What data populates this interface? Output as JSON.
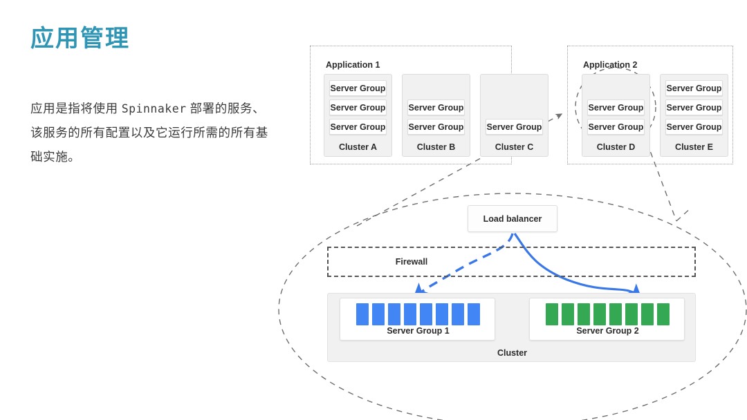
{
  "left_panel": {
    "title": "应用管理",
    "paragraph_part1": "应用是指将使用 ",
    "paragraph_latin": "Spinnaker",
    "paragraph_part2": " 部署的服务、该服务的所有配置以及它运行所需的所有基础实施。",
    "title_color": "#2e95b5"
  },
  "diagram": {
    "applications": [
      {
        "label": "Application 1",
        "clusters": [
          {
            "label": "Cluster A",
            "server_groups": [
              "Server Group",
              "Server Group",
              "Server Group"
            ]
          },
          {
            "label": "Cluster B",
            "server_groups": [
              "Server Group",
              "Server Group"
            ]
          },
          {
            "label": "Cluster C",
            "server_groups": [
              "Server Group"
            ]
          }
        ]
      },
      {
        "label": "Application 2",
        "clusters": [
          {
            "label": "Cluster D",
            "server_groups": [
              "Server Group",
              "Server Group"
            ]
          },
          {
            "label": "Cluster E",
            "server_groups": [
              "Server Group",
              "Server Group",
              "Server Group"
            ]
          }
        ]
      }
    ],
    "detail": {
      "load_balancer_label": "Load balancer",
      "firewall_label": "Firewall",
      "cluster_label": "Cluster",
      "server_groups": [
        {
          "label": "Server Group 1",
          "instance_count": 8,
          "color": "#4285f4"
        },
        {
          "label": "Server Group 2",
          "instance_count": 8,
          "color": "#34a853"
        }
      ]
    },
    "colors": {
      "instance_blue": "#4285f4",
      "instance_green": "#34a853",
      "arrow_blue": "#3b78e7",
      "dashed_gray": "#6e6e6e",
      "dotted_gray": "#9a9a9a"
    }
  }
}
